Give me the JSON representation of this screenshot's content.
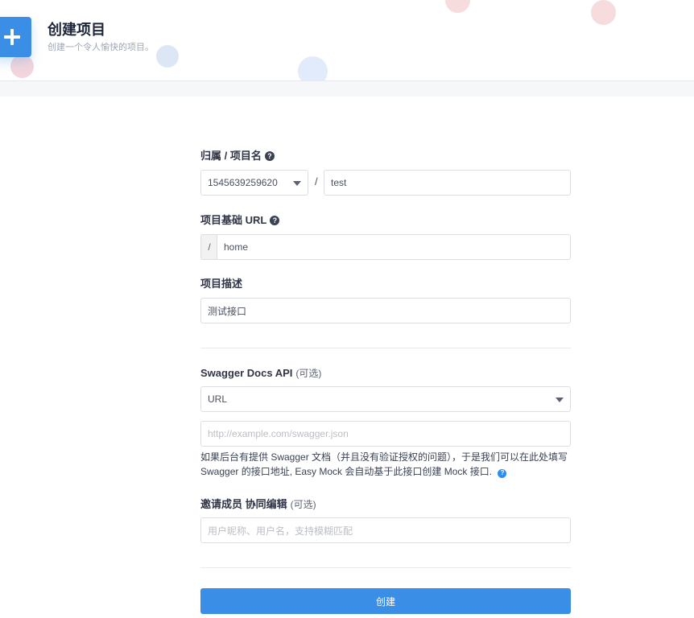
{
  "header": {
    "title": "创建项目",
    "subtitle": "创建一个令人愉快的项目。",
    "add_icon": "plus-icon"
  },
  "form": {
    "owner_project": {
      "label": "归属 / 项目名",
      "help_icon": "question-circle-icon",
      "owner_value": "1545639259620",
      "separator": "/",
      "project_name_value": "test"
    },
    "base_url": {
      "label": "项目基础 URL",
      "help_icon": "question-circle-icon",
      "prefix": "/",
      "value": "home"
    },
    "description": {
      "label": "项目描述",
      "value": "测试接口"
    },
    "swagger": {
      "label": "Swagger Docs API",
      "optional": "(可选)",
      "type_value": "URL",
      "url_placeholder": "http://example.com/swagger.json",
      "hint": "如果后台有提供 Swagger 文档（并且没有验证授权的问题），于是我们可以在此处填写 Swagger 的接口地址, Easy Mock 会自动基于此接口创建 Mock 接口.",
      "hint_icon": "question-circle-icon"
    },
    "members": {
      "label": "邀请成员 协同编辑",
      "optional": "(可选)",
      "placeholder": "用户昵称、用户名，支持模糊匹配"
    },
    "submit_label": "创建"
  },
  "colors": {
    "primary": "#3b8ee6",
    "border": "#dddee1",
    "title_text": "#1c2438",
    "subtitle_text": "#9ea7b4"
  }
}
